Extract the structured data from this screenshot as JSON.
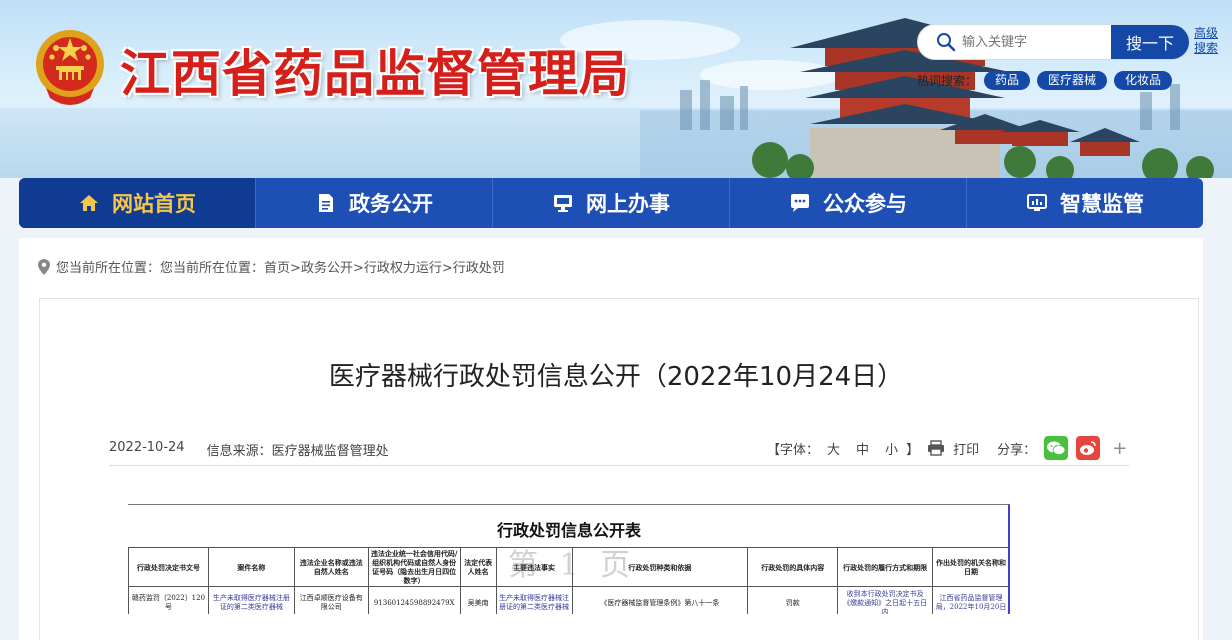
{
  "header": {
    "title": "江西省药品监督管理局",
    "search_placeholder": "输入关键字",
    "search_button": "搜一下",
    "advanced_search": "高级搜索",
    "hot_label": "热词搜索：",
    "hot_tags": [
      "药品",
      "医疗器械",
      "化妆品"
    ]
  },
  "nav": {
    "items": [
      {
        "label": "网站首页",
        "icon": "home-icon",
        "active": true
      },
      {
        "label": "政务公开",
        "icon": "document-icon"
      },
      {
        "label": "网上办事",
        "icon": "monitor-icon"
      },
      {
        "label": "公众参与",
        "icon": "chat-icon"
      },
      {
        "label": "智慧监管",
        "icon": "dashboard-icon"
      }
    ]
  },
  "breadcrumb": {
    "text": "您当前所在位置：您当前所在位置：",
    "links": [
      "首页",
      "政务公开",
      "行政权力运行",
      "行政处罚"
    ],
    "separator": ">"
  },
  "article": {
    "title": "医疗器械行政处罚信息公开（2022年10月24日）",
    "date": "2022-10-24",
    "source": "信息来源：医疗器械监督管理处",
    "font_label": "【字体：",
    "font_sizes": [
      "大",
      "中",
      "小"
    ],
    "font_close": "】",
    "print": "打印",
    "share_label": "分享：",
    "more": "+"
  },
  "document": {
    "title": "行政处罚信息公开表",
    "watermark": "第 1 页",
    "headers": [
      "行政处罚决定书文号",
      "案件名称",
      "违法企业名称或违法自然人姓名",
      "违法企业统一社会信用代码/组织机构代码或自然人身份证号码（隐去出生月日四位数字）",
      "法定代表人姓名",
      "主要违法事实",
      "行政处罚种类和依据",
      "行政处罚的具体内容",
      "行政处罚的履行方式和期限",
      "作出处罚的机关名称和日期"
    ],
    "row": [
      "赣药监罚〔2022〕120号",
      "生产未取得医疗器械注册证的第二类医疗器械",
      "江西卓顺医疗设备有限公司",
      "91360124598892479X",
      "吴美南",
      "生产未取得医疗器械注册证的第二类医疗器械",
      "《医疗器械监督管理条例》第八十一条",
      "罚款",
      "收到本行政处罚决定书及《缴款通知》之日起十五日内",
      "江西省药品监督管理局，2022年10月20日"
    ]
  },
  "colors": {
    "nav_bg": "#1e4fb5",
    "nav_active_bg": "#0f3b93",
    "nav_active_text": "#f6c64a",
    "title_red": "#d41f1b",
    "wechat": "#4ac03e",
    "weibo": "#e6463f"
  }
}
